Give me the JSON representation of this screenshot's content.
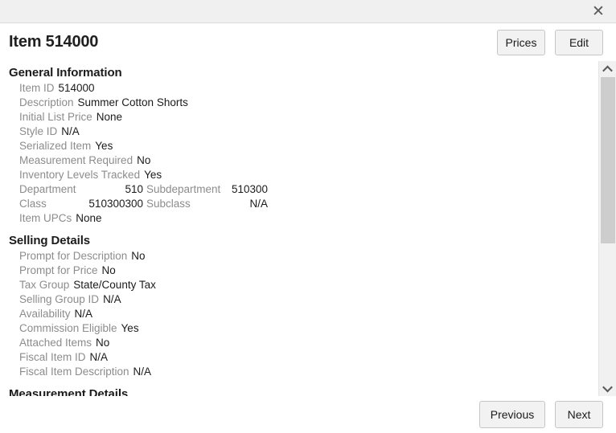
{
  "window": {
    "close_icon": "close-icon"
  },
  "header": {
    "title": "Item 514000",
    "prices_label": "Prices",
    "edit_label": "Edit"
  },
  "footer": {
    "previous_label": "Previous",
    "next_label": "Next"
  },
  "scrollbar": {
    "up_icon": "chevron-up-icon",
    "down_icon": "chevron-down-icon"
  },
  "sections": [
    {
      "title": "General Information",
      "fields": [
        {
          "label": "Item ID",
          "value": "514000"
        },
        {
          "label": "Description",
          "value": "Summer Cotton Shorts"
        },
        {
          "label": "Initial List Price",
          "value": "None"
        },
        {
          "label": "Style ID",
          "value": "N/A"
        },
        {
          "label": "Serialized Item",
          "value": "Yes"
        },
        {
          "label": "Measurement Required",
          "value": "No"
        },
        {
          "label": "Inventory Levels Tracked",
          "value": "Yes"
        },
        {
          "label": "Department",
          "value": "510",
          "label2": "Subdepartment",
          "value2": "510300"
        },
        {
          "label": "Class",
          "value": "510300300",
          "label2": "Subclass",
          "value2": "N/A"
        },
        {
          "label": "Item UPCs",
          "value": "None"
        }
      ]
    },
    {
      "title": "Selling Details",
      "fields": [
        {
          "label": "Prompt for Description",
          "value": "No"
        },
        {
          "label": "Prompt for Price",
          "value": "No"
        },
        {
          "label": "Tax Group",
          "value": "State/County Tax"
        },
        {
          "label": "Selling Group ID",
          "value": "N/A"
        },
        {
          "label": "Availability",
          "value": "N/A"
        },
        {
          "label": "Commission Eligible",
          "value": "Yes"
        },
        {
          "label": "Attached Items",
          "value": "No"
        },
        {
          "label": "Fiscal Item ID",
          "value": "N/A"
        },
        {
          "label": "Fiscal Item Description",
          "value": "N/A"
        }
      ]
    },
    {
      "title": "Measurement Details",
      "fields": []
    }
  ]
}
